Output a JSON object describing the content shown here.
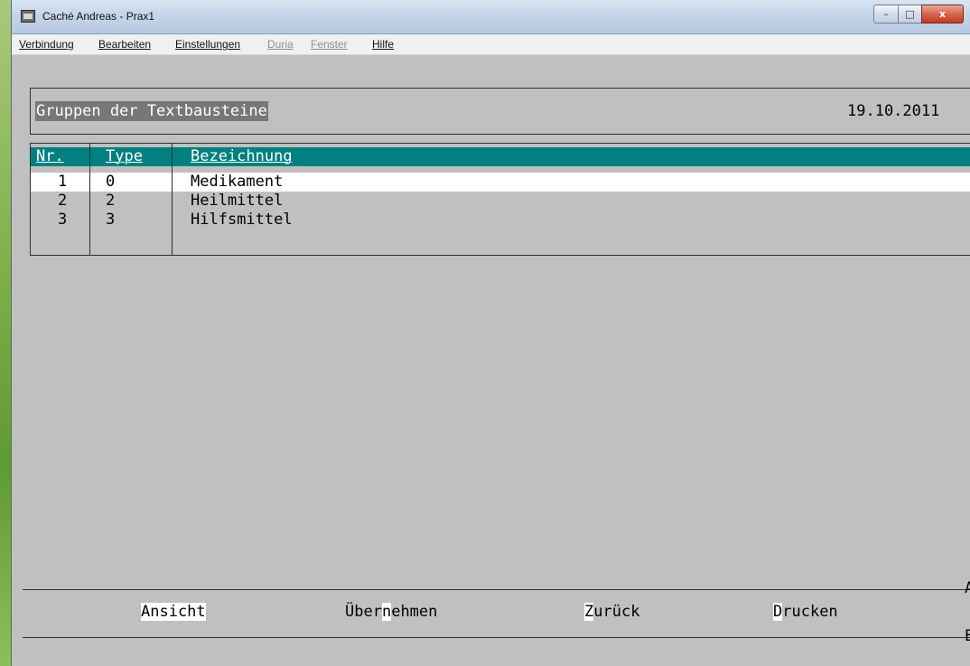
{
  "window": {
    "title": "Caché Andreas - Prax1",
    "controls": {
      "minimize": "–",
      "maximize": "□",
      "close": "x"
    }
  },
  "menu": [
    {
      "label": "Verbindung",
      "enabled": true
    },
    {
      "label": "Bearbeiten",
      "enabled": true
    },
    {
      "label": "Einstellungen",
      "enabled": true
    },
    {
      "label": "Duria",
      "enabled": false
    },
    {
      "label": "Fenster",
      "enabled": false
    },
    {
      "label": "Hilfe",
      "enabled": true
    }
  ],
  "header": {
    "title": "Gruppen der Textbausteine",
    "date": "19.10.2011"
  },
  "table": {
    "columns": [
      "Nr.",
      "Type",
      "Bezeichnung"
    ],
    "rows": [
      {
        "nr": "1",
        "type": "0",
        "bezeichnung": "Medikament",
        "selected": true
      },
      {
        "nr": "2",
        "type": "2",
        "bezeichnung": "Heilmittel",
        "selected": false
      },
      {
        "nr": "3",
        "type": "3",
        "bezeichnung": "Hilfsmittel",
        "selected": false
      }
    ]
  },
  "function_keys": [
    {
      "pre": "",
      "hot": "Ansicht",
      "post": ""
    },
    {
      "pre": "Über",
      "hot": "n",
      "post": "ehmen"
    },
    {
      "pre": "",
      "hot": "Z",
      "post": "urück"
    },
    {
      "pre": "",
      "hot": "D",
      "post": "rucken"
    }
  ],
  "edge_labels": [
    "A",
    "E"
  ],
  "colors": {
    "table_header": "#008080",
    "background": "#c0c0c0",
    "highlight": "#ffffff"
  }
}
